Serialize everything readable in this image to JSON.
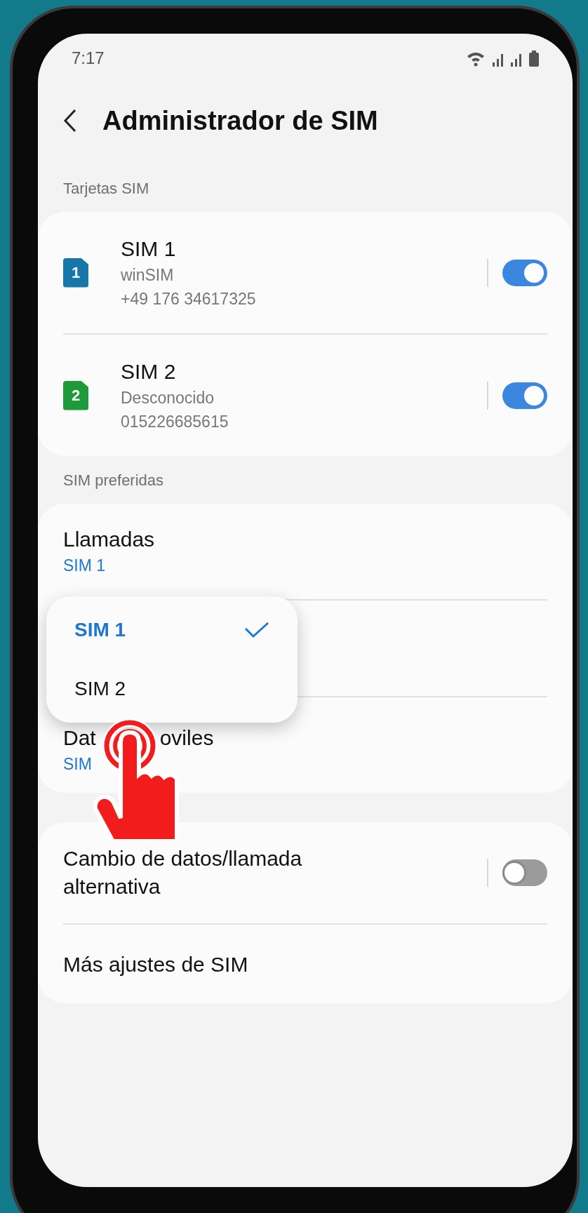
{
  "status_bar": {
    "time": "7:17"
  },
  "header": {
    "title": "Administrador de SIM"
  },
  "sections": [
    {
      "title": "Tarjetas SIM",
      "rows": [
        {
          "kind": "sim",
          "badge": "1",
          "color": "#1677a8",
          "title": "SIM 1",
          "lines": [
            "winSIM",
            "+49 176 34617325"
          ],
          "on": true
        },
        {
          "kind": "sim",
          "badge": "2",
          "color": "#1f9a3a",
          "title": "SIM 2",
          "lines": [
            "Desconocido",
            "015226685615"
          ],
          "on": true
        }
      ]
    },
    {
      "title": "SIM preferidas",
      "rows": [
        {
          "kind": "pref",
          "title": "Llamadas",
          "value": "SIM 1"
        },
        {
          "kind": "hidden"
        },
        {
          "kind": "partial",
          "title_parts": [
            "Dat",
            "oviles"
          ],
          "value": "SIM"
        }
      ]
    },
    {
      "rows": [
        {
          "kind": "switch",
          "title": "Cambio de datos/llamada alternativa",
          "on": false
        },
        {
          "kind": "link",
          "title": "Más ajustes de SIM"
        }
      ]
    }
  ],
  "popup": {
    "options": [
      {
        "label": "SIM 1",
        "selected": true
      },
      {
        "label": "SIM 2",
        "selected": false
      }
    ]
  }
}
